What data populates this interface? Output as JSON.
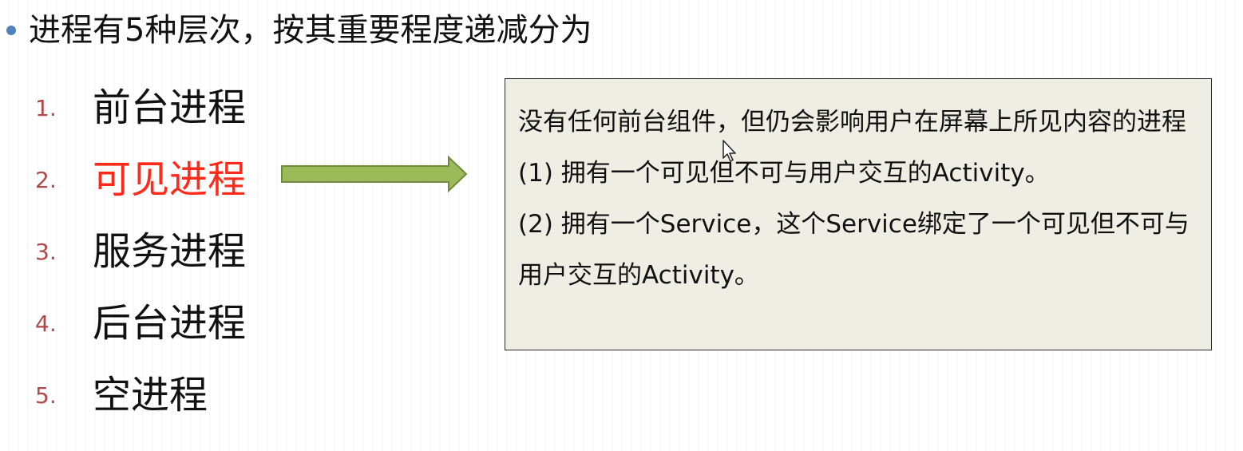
{
  "headline": "进程有5种层次，按其重要程度递减分为",
  "list": [
    {
      "num": "1.",
      "label": "前台进程"
    },
    {
      "num": "2.",
      "label": "可见进程",
      "highlight": true
    },
    {
      "num": "3.",
      "label": "服务进程"
    },
    {
      "num": "4.",
      "label": "后台进程"
    },
    {
      "num": "5.",
      "label": "空进程"
    }
  ],
  "callout": {
    "paragraphs": [
      "没有任何前台组件，但仍会影响用户在屏幕上所见内容的进程",
      "(1) 拥有一个可见但不可与用户交互的Activity。",
      "(2) 拥有一个Service，这个Service绑定了一个可见但不可与用户交互的Activity。"
    ]
  },
  "icons": {
    "bullet": "bullet-dot-icon",
    "arrow": "right-arrow-icon",
    "cursor": "mouse-pointer-icon"
  },
  "colors": {
    "bullet": "#4f81bd",
    "number": "#b04a4a",
    "highlight": "#ff2a1a",
    "arrow_fill": "#9bbb59",
    "arrow_stroke": "#71893f",
    "callout_bg": "#eeeee5"
  }
}
